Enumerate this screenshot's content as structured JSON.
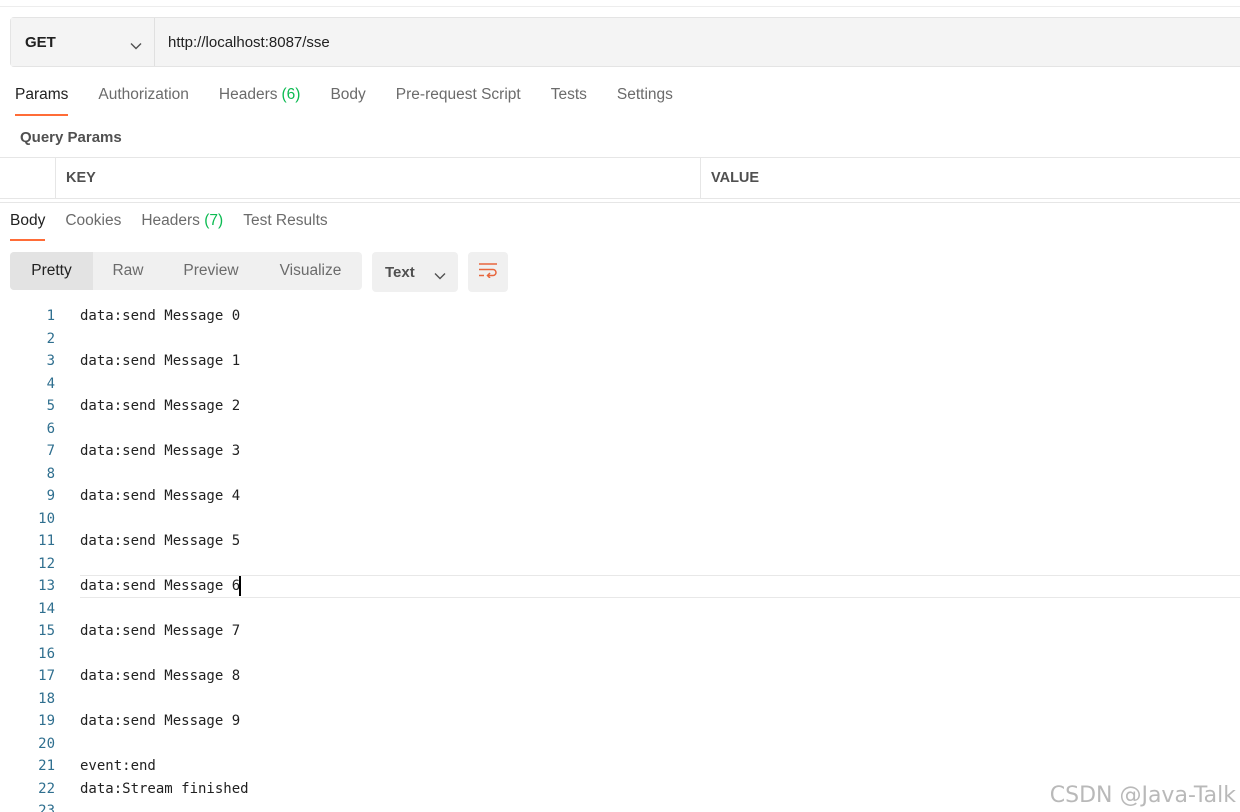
{
  "request": {
    "method": "GET",
    "url": "http://localhost:8087/sse"
  },
  "request_tabs": {
    "params": "Params",
    "authorization": "Authorization",
    "headers": "Headers",
    "headers_count": "(6)",
    "body": "Body",
    "prerequest": "Pre-request Script",
    "tests": "Tests",
    "settings": "Settings"
  },
  "query_params": {
    "title": "Query Params",
    "key_header": "KEY",
    "value_header": "VALUE"
  },
  "response_tabs": {
    "body": "Body",
    "cookies": "Cookies",
    "headers": "Headers",
    "headers_count": "(7)",
    "test_results": "Test Results"
  },
  "format_toolbar": {
    "pretty": "Pretty",
    "raw": "Raw",
    "preview": "Preview",
    "visualize": "Visualize",
    "type": "Text"
  },
  "code": {
    "lines": [
      {
        "n": "1",
        "t": "data:send Message 0"
      },
      {
        "n": "2",
        "t": ""
      },
      {
        "n": "3",
        "t": "data:send Message 1"
      },
      {
        "n": "4",
        "t": ""
      },
      {
        "n": "5",
        "t": "data:send Message 2"
      },
      {
        "n": "6",
        "t": ""
      },
      {
        "n": "7",
        "t": "data:send Message 3"
      },
      {
        "n": "8",
        "t": ""
      },
      {
        "n": "9",
        "t": "data:send Message 4"
      },
      {
        "n": "10",
        "t": ""
      },
      {
        "n": "11",
        "t": "data:send Message 5"
      },
      {
        "n": "12",
        "t": ""
      },
      {
        "n": "13",
        "t": "data:send Message 6"
      },
      {
        "n": "14",
        "t": ""
      },
      {
        "n": "15",
        "t": "data:send Message 7"
      },
      {
        "n": "16",
        "t": ""
      },
      {
        "n": "17",
        "t": "data:send Message 8"
      },
      {
        "n": "18",
        "t": ""
      },
      {
        "n": "19",
        "t": "data:send Message 9"
      },
      {
        "n": "20",
        "t": ""
      },
      {
        "n": "21",
        "t": "event:end"
      },
      {
        "n": "22",
        "t": "data:Stream finished"
      },
      {
        "n": "23",
        "t": ""
      }
    ],
    "current_line": 13
  },
  "watermark": "CSDN @Java-Talk",
  "colors": {
    "accent": "#ff6c37",
    "count_green": "#0cbb52",
    "line_number": "#2f6f8f"
  },
  "icons": {
    "method_dropdown": "chevron-down-icon",
    "type_dropdown": "chevron-down-icon",
    "wrap": "wrap-lines-icon"
  }
}
